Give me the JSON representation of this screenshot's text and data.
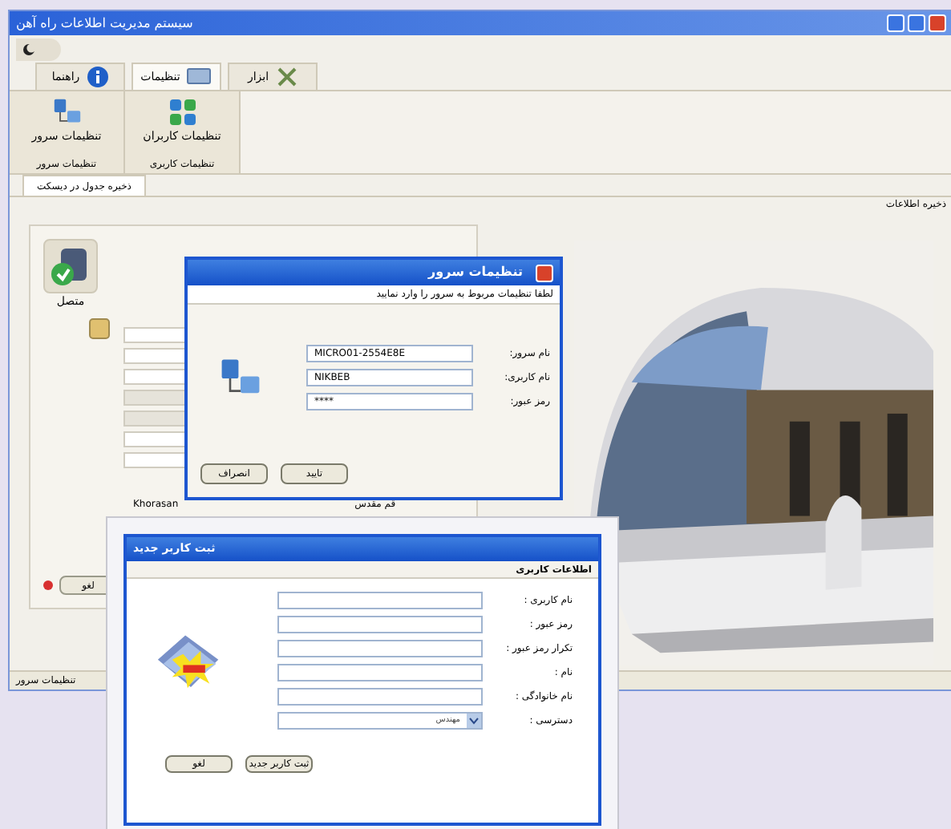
{
  "window": {
    "title": "سیستم مدیریت اطلاعات راه آهن"
  },
  "ribbon_tabs": [
    {
      "label": "ابزار",
      "kind": "tools",
      "selected": false
    },
    {
      "label": "تنظیمات",
      "kind": "settings",
      "selected": true
    },
    {
      "label": "راهنما",
      "kind": "info",
      "selected": false
    }
  ],
  "ribbon_groups": [
    {
      "label": "تنظیمات کاربری",
      "button": "تنظیمات کاربران",
      "kind": "users"
    },
    {
      "label": "تنظیمات سرور",
      "button": "تنظیمات سرور",
      "kind": "server"
    }
  ],
  "document_tabs": [
    {
      "label": "ذخیره جدول در دیسکت",
      "selected": true
    }
  ],
  "section_title": "ذخیره اطلاعات",
  "connection": {
    "status": "متصل",
    "connected": true
  },
  "panel": {
    "cell_1": "Khorasan",
    "cell_2": "قم مقدس",
    "cancel_button": "لغو"
  },
  "status_bar": "تنظیمات سرور",
  "server_dialog": {
    "title": "تنظیمات سرور",
    "heading": "لطفا تنظیمات مربوط به سرور را وارد نمایید",
    "fields": [
      {
        "label": "نام سرور:",
        "value": "MICRO01-2554E8E"
      },
      {
        "label": "نام کاربری:",
        "value": "NIKBEB"
      },
      {
        "label": "رمز عبور:",
        "value": "****"
      }
    ],
    "buttons": [
      "تایید",
      "انصراف"
    ]
  },
  "user_dialog": {
    "title": "ثبت کاربر جدید",
    "heading": "اطلاعات کاربری",
    "fields": [
      {
        "label": "نام کاربری :",
        "kind": "text"
      },
      {
        "label": "رمز عبور :",
        "kind": "text"
      },
      {
        "label": "تکرار رمز عبور :",
        "kind": "text"
      },
      {
        "label": "نام :",
        "kind": "text"
      },
      {
        "label": "نام خانوادگی :",
        "kind": "text"
      },
      {
        "label": "دسترسی :",
        "kind": "select",
        "value": "مهندس"
      }
    ],
    "buttons": [
      "ثبت کاربر جدید",
      "لغو"
    ]
  }
}
